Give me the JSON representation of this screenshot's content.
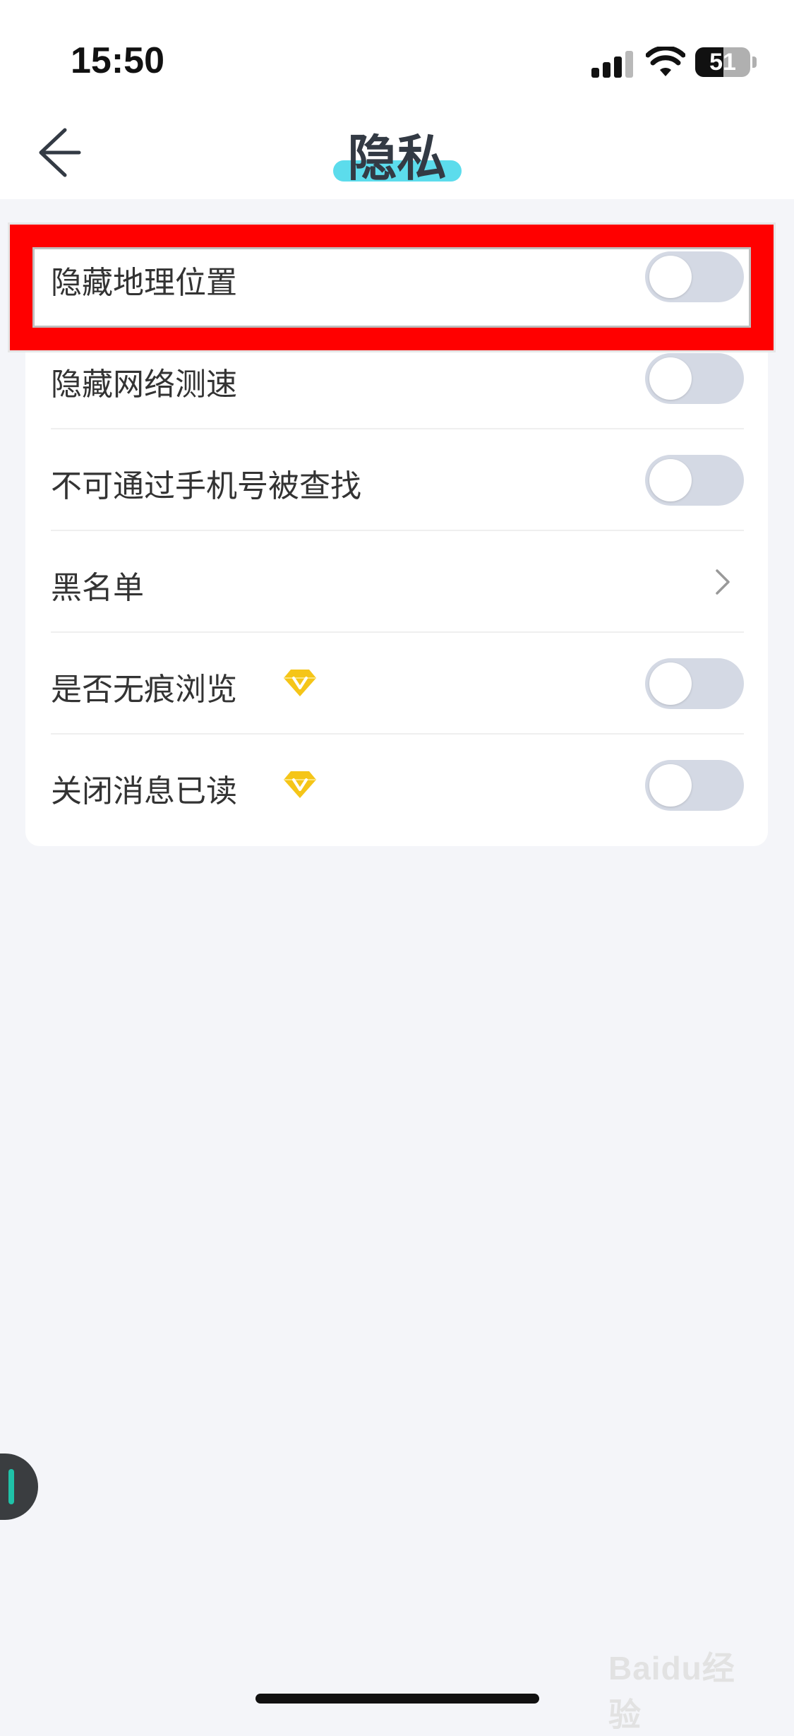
{
  "status_bar": {
    "time": "15:50",
    "battery_level": "51",
    "icons": [
      "signal-icon",
      "wifi-icon",
      "battery-icon"
    ]
  },
  "header": {
    "title": "隐私",
    "back_icon": "arrow-left-icon",
    "accent_color": "#5cdcec"
  },
  "settings": [
    {
      "label": "隐藏地理位置",
      "control": "toggle",
      "on": false,
      "vip": false,
      "highlighted": true
    },
    {
      "label": "隐藏网络测速",
      "control": "toggle",
      "on": false,
      "vip": false
    },
    {
      "label": "不可通过手机号被查找",
      "control": "toggle",
      "on": false,
      "vip": false
    },
    {
      "label": "黑名单",
      "control": "chevron",
      "vip": false
    },
    {
      "label": "是否无痕浏览",
      "control": "toggle",
      "on": false,
      "vip": true
    },
    {
      "label": "关闭消息已读",
      "control": "toggle",
      "on": false,
      "vip": true
    }
  ],
  "colors": {
    "highlight_border": "#ff0000",
    "toggle_off": "#d4d9e4",
    "vip_diamond": "#f5c518",
    "background": "#f4f5f9"
  },
  "watermark": {
    "text": "Baidu经验"
  }
}
